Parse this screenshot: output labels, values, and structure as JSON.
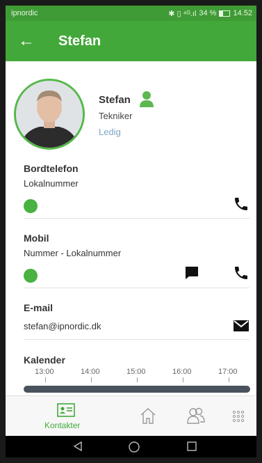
{
  "status_bar": {
    "carrier": "ipnordic",
    "battery": "34 %",
    "time": "14.52"
  },
  "app_bar": {
    "title": "Stefan"
  },
  "profile": {
    "name": "Stefan",
    "role": "Tekniker",
    "status": "Ledig"
  },
  "bordtelefon": {
    "title": "Bordtelefon",
    "subtitle": "Lokalnummer"
  },
  "mobil": {
    "title": "Mobil",
    "subtitle": "Nummer - Lokalnummer"
  },
  "email": {
    "title": "E-mail",
    "address": "stefan@ipnordic.dk"
  },
  "calendar": {
    "title": "Kalender",
    "hours": [
      "13:00",
      "14:00",
      "15:00",
      "16:00",
      "17:00"
    ]
  },
  "bottom_nav": {
    "contacts_label": "Kontakter"
  },
  "colors": {
    "primary": "#43a83a",
    "status_dark": "#3f9b35",
    "available": "#49b241",
    "timeline": "#49525d"
  },
  "icons": [
    "arrow-left-icon",
    "person-icon",
    "phone-icon",
    "chat-icon",
    "mail-icon",
    "contact-card-icon",
    "home-icon",
    "group-icon",
    "apps-grid-icon"
  ]
}
